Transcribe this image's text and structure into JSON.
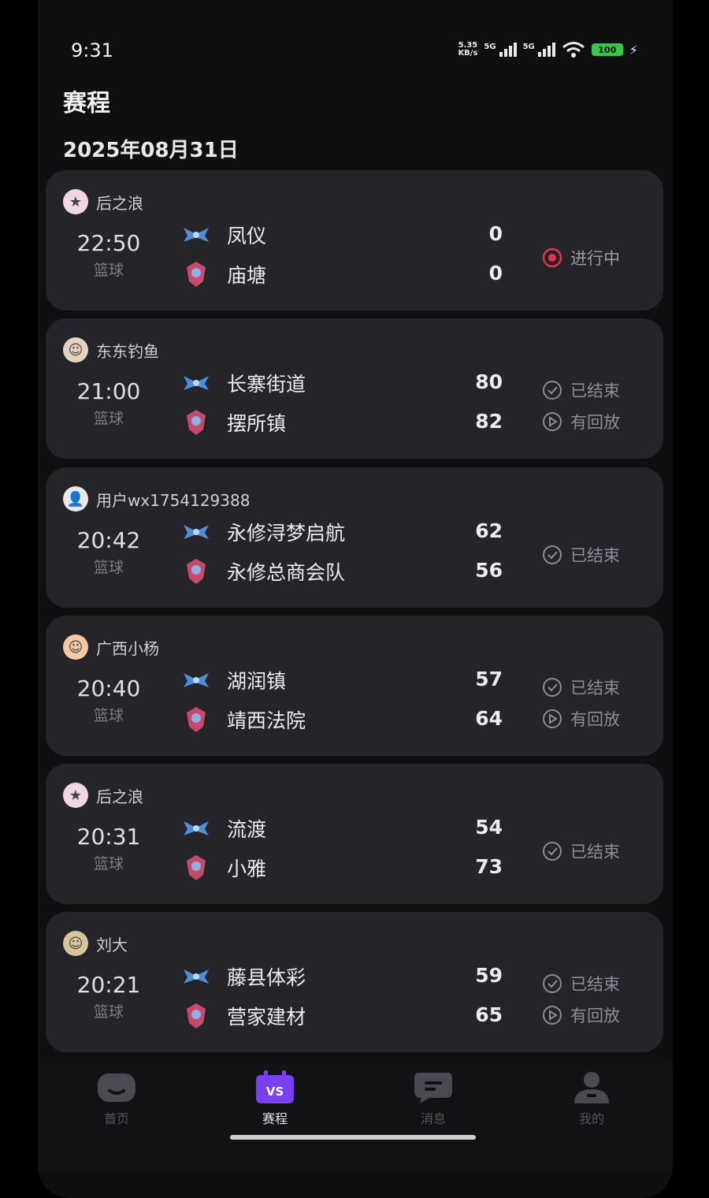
{
  "status_bar": {
    "time": "9:31",
    "net_speed_value": "5.35",
    "net_speed_unit": "KB/s",
    "signal1": "5G",
    "signal2": "5G",
    "battery": "100"
  },
  "page": {
    "title": "赛程",
    "date": "2025年08月31日"
  },
  "matches": [
    {
      "host": "后之浪",
      "time": "22:50",
      "sport": "篮球",
      "team1": "凤仪",
      "score1": "0",
      "team2": "庙塘",
      "score2": "0",
      "status": "进行中",
      "replay": ""
    },
    {
      "host": "东东钓鱼",
      "time": "21:00",
      "sport": "篮球",
      "team1": "长寨街道",
      "score1": "80",
      "team2": "摆所镇",
      "score2": "82",
      "status": "已结束",
      "replay": "有回放"
    },
    {
      "host": "用户wx1754129388",
      "time": "20:42",
      "sport": "篮球",
      "team1": "永修浔梦启航",
      "score1": "62",
      "team2": "永修总商会队",
      "score2": "56",
      "status": "已结束",
      "replay": ""
    },
    {
      "host": "广西小杨",
      "time": "20:40",
      "sport": "篮球",
      "team1": "湖润镇",
      "score1": "57",
      "team2": "靖西法院",
      "score2": "64",
      "status": "已结束",
      "replay": "有回放"
    },
    {
      "host": "后之浪",
      "time": "20:31",
      "sport": "篮球",
      "team1": "流渡",
      "score1": "54",
      "team2": "小雅",
      "score2": "73",
      "status": "已结束",
      "replay": ""
    },
    {
      "host": "刘大",
      "time": "20:21",
      "sport": "篮球",
      "team1": "藤县体彩",
      "score1": "59",
      "team2": "营家建材",
      "score2": "65",
      "status": "已结束",
      "replay": "有回放"
    }
  ],
  "nav": {
    "home": "首页",
    "schedule": "赛程",
    "schedule_badge": "VS",
    "messages": "消息",
    "mine": "我的"
  },
  "colors": {
    "live": "#e8334a",
    "active_tab": "#7b3ff2",
    "card_bg": "#24242a"
  }
}
